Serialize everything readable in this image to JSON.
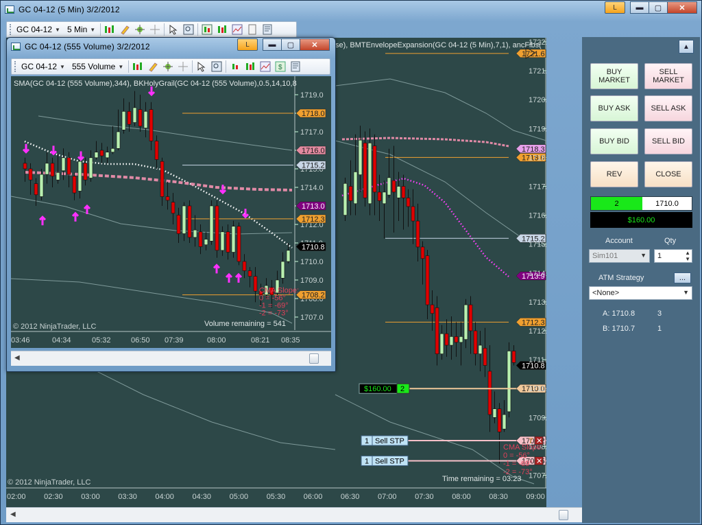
{
  "main_window": {
    "title": "GC 04-12 (5 Min)  3/2/2012",
    "link_btn": "L",
    "minimize": "▬",
    "maximize": "▢",
    "close": "✕",
    "toolbar": {
      "instrument": "GC 04-12",
      "period": "5 Min"
    },
    "indicator_line": "se), BMTEnvelopeExpansion(GC 04-12 (5 Min),7,1), ancFibs(",
    "copyright": "© 2012 NinjaTrader, LLC",
    "time_remaining": "Time remaining = 03:23",
    "cma_text": [
      "CMA Slope:",
      "0 = -56°",
      "-1 = -69°",
      "-2 = -73°"
    ],
    "y_ticks": [
      "1722.0",
      "1721.0",
      "1720.0",
      "1719.0",
      "1718.0",
      "1717.0",
      "1716.0",
      "1715.0",
      "1714.0",
      "1713.0",
      "1712.0",
      "1711.0",
      "1710.0",
      "1709.0",
      "1708.0",
      "1707.0"
    ],
    "x_ticks": [
      "02:00",
      "02:30",
      "03:00",
      "03:30",
      "04:00",
      "04:30",
      "05:00",
      "05:30",
      "06:00",
      "06:30",
      "07:00",
      "07:30",
      "08:00",
      "08:30",
      "09:00"
    ],
    "fib_labels": [
      {
        "text": "23.6",
        "tag": "1721.6",
        "color": "#f0a030"
      },
      {
        "text": "38.2",
        "tag": "1718.0",
        "color": "#f0a030"
      },
      {
        "text": "50.0",
        "tag": "1715.2",
        "color": "#c8d6e6"
      },
      {
        "text": "61.8",
        "tag": "1712.3",
        "color": "#f0a030"
      }
    ],
    "price_tags": [
      {
        "text": "1718.3",
        "color": "#e6a0ea"
      },
      {
        "text": "1713.9",
        "color": "#800080"
      },
      {
        "text": "1710.8",
        "color": "#000000"
      },
      {
        "text": "1710.0",
        "color": "#f0c89a"
      },
      {
        "text": "1708.2",
        "color": "#f6c0c8"
      },
      {
        "text": "1707.5",
        "color": "#f6c0c8"
      }
    ],
    "pnl_marker": {
      "pnl": "$160.00",
      "qty": "2"
    },
    "orders": [
      {
        "qty": "1",
        "label": "Sell STP"
      },
      {
        "qty": "1",
        "label": "Sell STP"
      }
    ],
    "order_cancel": "✕",
    "order_fragment": "7"
  },
  "inner_window": {
    "title": "GC 04-12 (555 Volume)  3/2/2012",
    "link_btn": "L",
    "toolbar": {
      "instrument": "GC 04-12",
      "period": "555 Volume"
    },
    "indicator_line": "SMA(GC 04-12 (555 Volume),344), BKHolyGrail(GC 04-12 (555 Volume),0.5,14,10,8",
    "copyright": "© 2012 NinjaTrader, LLC",
    "volume_remaining": "Volume remaining = 541",
    "y_ticks": [
      "1719.0",
      "1718.0",
      "1717.0",
      "1716.0",
      "1715.0",
      "1714.0",
      "1713.0",
      "1712.0",
      "1711.0",
      "1710.0",
      "1709.0",
      "1708.0",
      "1707.0"
    ],
    "x_ticks": [
      "03:46",
      "04:34",
      "05:32",
      "06:50",
      "07:39",
      "08:00",
      "08:21",
      "08:35"
    ],
    "price_tags": [
      {
        "text": "1718.0",
        "color": "#f0a030"
      },
      {
        "text": "1716.0",
        "color": "#e28aa0"
      },
      {
        "text": "1715.2",
        "color": "#c8d6e6"
      },
      {
        "text": "1713.0",
        "color": "#800080"
      },
      {
        "text": "1712.3",
        "color": "#f0a030"
      },
      {
        "text": "1710.8",
        "color": "#000000"
      },
      {
        "text": "1708.2",
        "color": "#f0a030"
      }
    ],
    "cma_text": [
      "CMA Slope:",
      "0 = -56°",
      "-1 = -69°",
      "-2 = -73°"
    ]
  },
  "order_panel": {
    "buy_market": [
      "BUY",
      "MARKET"
    ],
    "sell_market": [
      "SELL",
      "MARKET"
    ],
    "buy_ask": "BUY ASK",
    "sell_ask": "SELL ASK",
    "buy_bid": "BUY BID",
    "sell_bid": "SELL BID",
    "rev": "REV",
    "close": "CLOSE",
    "position_qty": "2",
    "position_price": "1710.0",
    "pnl": "$160.00",
    "account_label": "Account",
    "qty_label": "Qty",
    "account": "Sim101",
    "qty": "1",
    "atm_label": "ATM Strategy",
    "atm_more": "...",
    "atm_value": "<None>",
    "a_label": "A: 1710.8",
    "a_qty": "3",
    "b_label": "B: 1710.7",
    "b_qty": "1"
  },
  "colors": {
    "chart_bg": "#2d4848",
    "up_candle": "#b8f0b0",
    "down_candle": "#e00000",
    "fib_orange": "#f0a030",
    "sma_pink": "#e08aa6",
    "envelope_dots": "#ffffff",
    "magenta_dots": "#ff40ff"
  }
}
